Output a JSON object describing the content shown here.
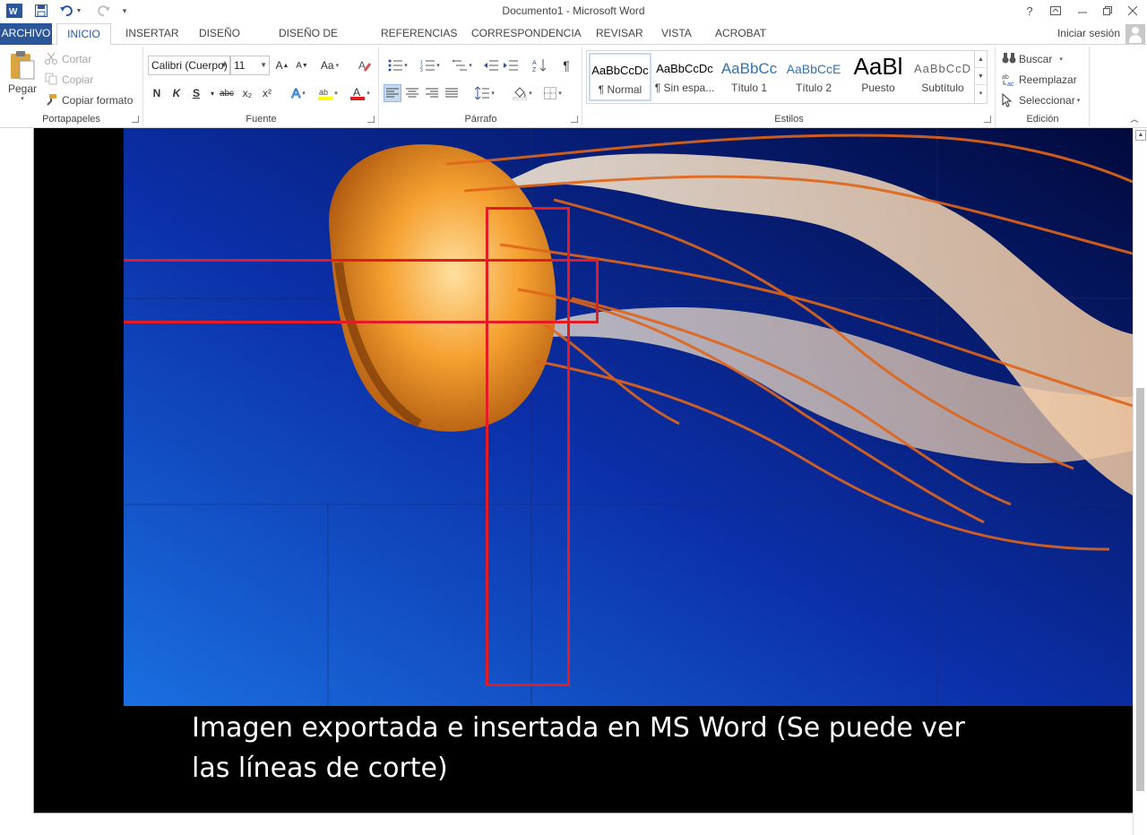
{
  "window": {
    "title": "Documento1 - Microsoft Word",
    "help": "?",
    "account": "Iniciar sesión"
  },
  "tabs": [
    {
      "label": "ARCHIVO"
    },
    {
      "label": "INICIO",
      "active": true
    },
    {
      "label": "INSERTAR"
    },
    {
      "label": "DISEÑO"
    },
    {
      "label": "DISEÑO DE PÁGINA"
    },
    {
      "label": "REFERENCIAS"
    },
    {
      "label": "CORRESPONDENCIA"
    },
    {
      "label": "REVISAR"
    },
    {
      "label": "VISTA"
    },
    {
      "label": "ACROBAT"
    }
  ],
  "clipboard": {
    "paste": "Pegar",
    "cut": "Cortar",
    "copy": "Copiar",
    "format_painter": "Copiar formato",
    "group": "Portapapeles"
  },
  "font": {
    "name": "Calibri (Cuerpo)",
    "size": "11",
    "bold": "N",
    "italic": "K",
    "underline": "S",
    "strike": "abc",
    "subscript": "x₂",
    "superscript": "x²",
    "case": "Aa",
    "grow": "A",
    "shrink": "A",
    "color_a": "A",
    "group": "Fuente"
  },
  "paragraph": {
    "pilcrow": "¶",
    "group": "Párrafo"
  },
  "styles": {
    "items": [
      {
        "sample": "AaBbCcDc",
        "name": "¶ Normal",
        "selected": true
      },
      {
        "sample": "AaBbCcDc",
        "name": "¶ Sin espa..."
      },
      {
        "sample": "AaBbCc",
        "name": "Título 1"
      },
      {
        "sample": "AaBbCcE",
        "name": "Título 2"
      },
      {
        "sample": "AaBl",
        "name": "Puesto"
      },
      {
        "sample": "AaBbCcD",
        "name": "Subtítulo"
      }
    ],
    "group": "Estilos"
  },
  "editing": {
    "find": "Buscar",
    "replace": "Reemplazar",
    "select": "Seleccionar",
    "group": "Edición"
  },
  "document": {
    "caption": "Imagen exportada e insertada en MS Word (Se puede ver las líneas de corte)"
  },
  "colors": {
    "file_tab": "#2b579a",
    "accent": "#2b579a",
    "highlight_box": "#e31b23",
    "ocean_light": "#1a6fe0",
    "ocean_dark": "#020a3c",
    "jelly_orange": "#f08a1e"
  }
}
